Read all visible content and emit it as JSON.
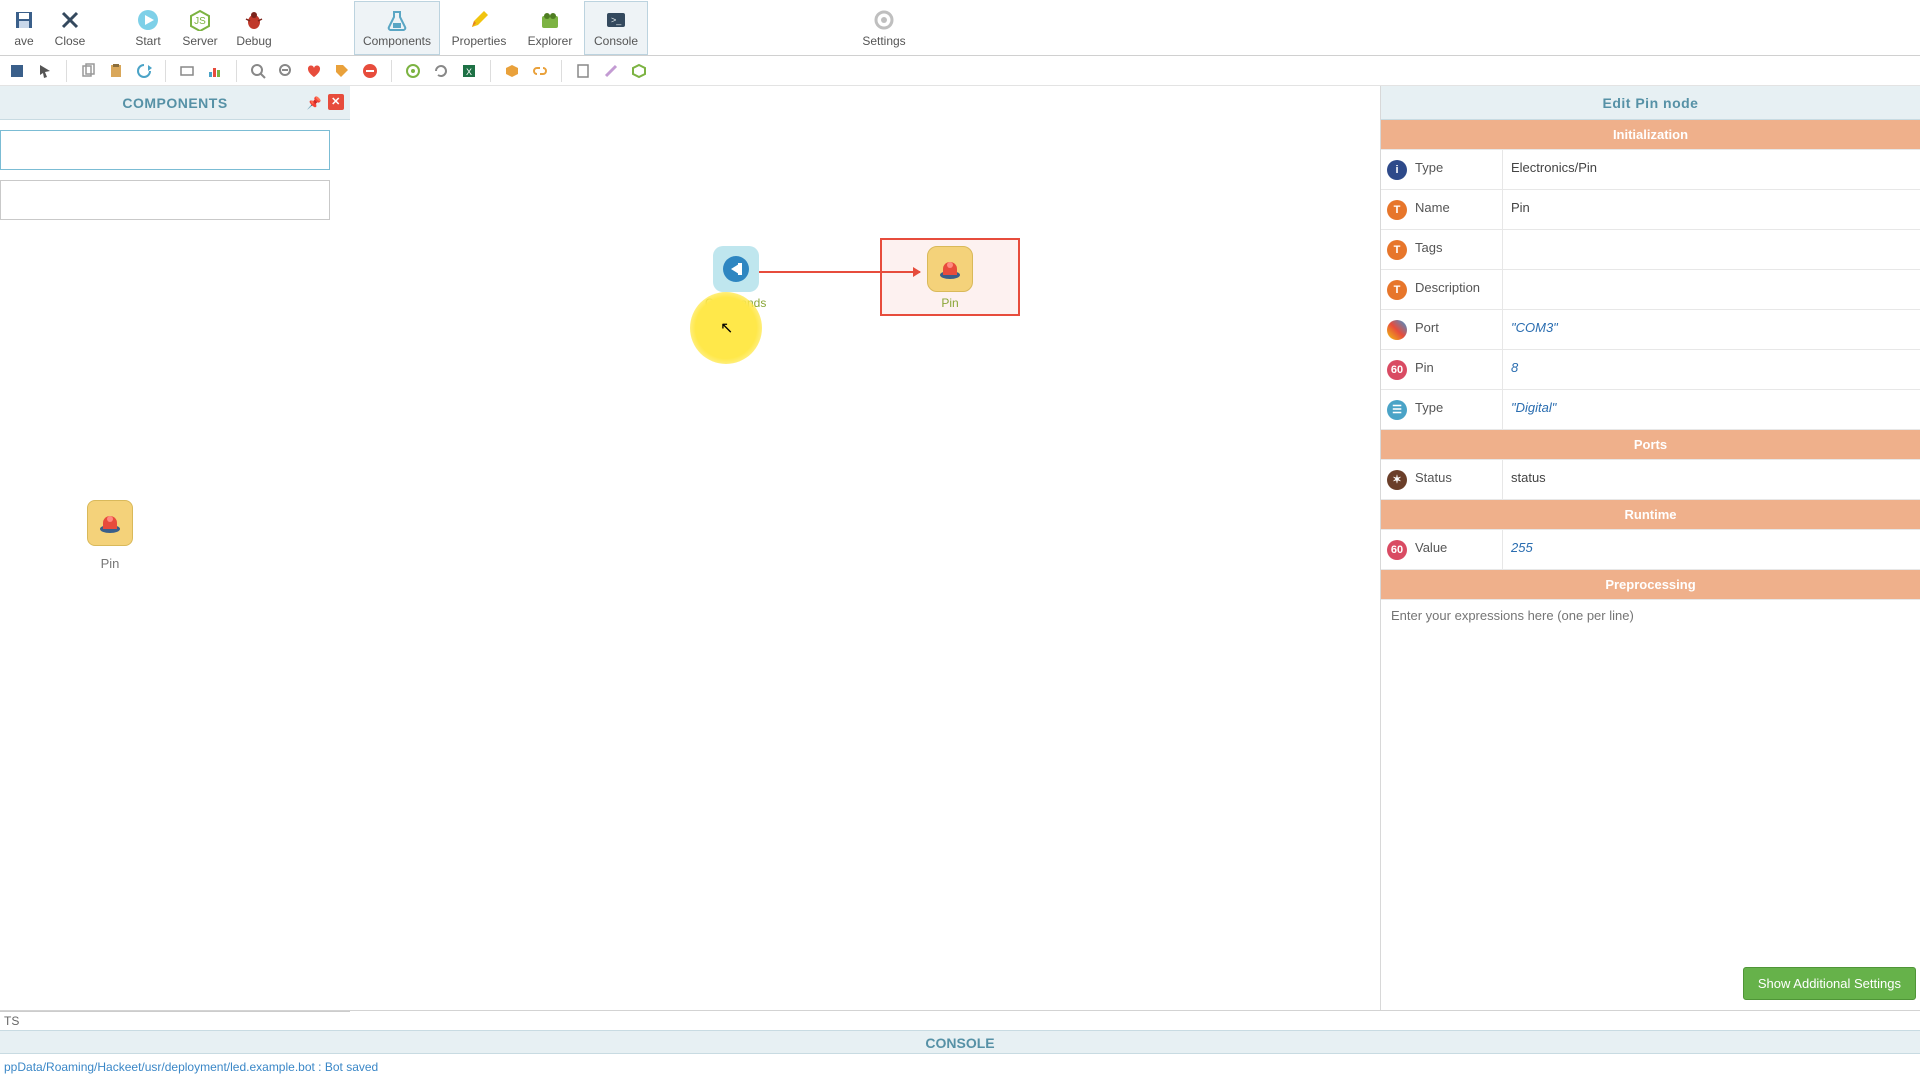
{
  "toolbar": {
    "save": "ave",
    "close": "Close",
    "start": "Start",
    "server": "Server",
    "debug": "Debug",
    "components": "Components",
    "properties": "Properties",
    "explorer": "Explorer",
    "console": "Console",
    "settings": "Settings"
  },
  "left_panel": {
    "title": "COMPONENTS",
    "search_placeholder": "",
    "filter_placeholder": "",
    "palette": {
      "pin_label": "Pin"
    }
  },
  "canvas": {
    "node_commands_label": "Commands",
    "node_pin_label": "Pin"
  },
  "right_panel": {
    "title": "Edit Pin node",
    "sections": {
      "init": "Initialization",
      "ports": "Ports",
      "runtime": "Runtime",
      "preproc": "Preprocessing"
    },
    "rows": {
      "type1_label": "Type",
      "type1_value": "Electronics/Pin",
      "name_label": "Name",
      "name_value": "Pin",
      "tags_label": "Tags",
      "tags_value": "",
      "desc_label": "Description",
      "desc_value": "",
      "port_label": "Port",
      "port_value": "\"COM3\"",
      "pin_label": "Pin",
      "pin_value": "8",
      "type2_label": "Type",
      "type2_value": "\"Digital\"",
      "status_label": "Status",
      "status_value": "status",
      "value_label": "Value",
      "value_value": "255"
    },
    "expr_placeholder": "Enter your expressions here (one per line)",
    "show_additional": "Show Additional Settings"
  },
  "console": {
    "ts_label": "TS",
    "title": "CONSOLE",
    "line": "ppData/Roaming/Hackeet/usr/deployment/led.example.bot : Bot saved"
  }
}
